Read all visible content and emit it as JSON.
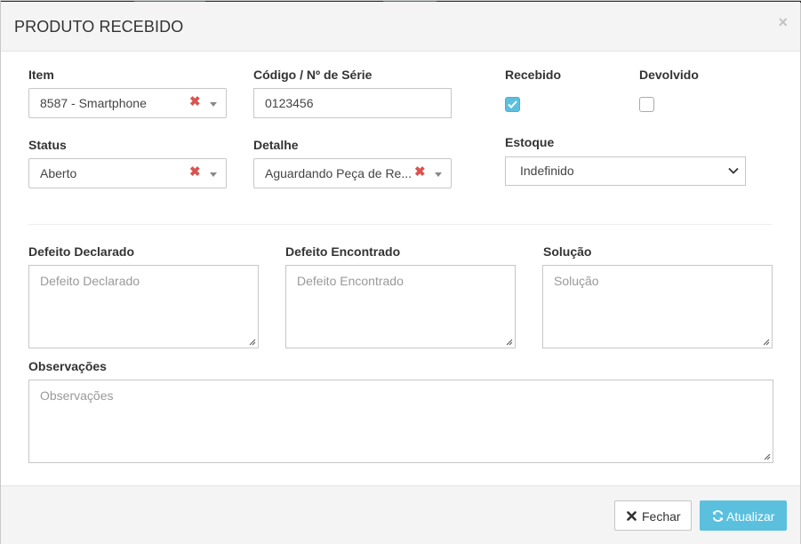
{
  "modal": {
    "title": "PRODUTO RECEBIDO",
    "close_glyph": "×"
  },
  "form": {
    "item": {
      "label": "Item",
      "value": "8587 - Smartphone",
      "clear_glyph": "✖"
    },
    "codigo": {
      "label": "Código / Nº de Série",
      "value": "0123456"
    },
    "recebido": {
      "label": "Recebido",
      "checked": true
    },
    "devolvido": {
      "label": "Devolvido",
      "checked": false
    },
    "status": {
      "label": "Status",
      "value": "Aberto",
      "clear_glyph": "✖"
    },
    "detalhe": {
      "label": "Detalhe",
      "value": "Aguardando Peça de Re...",
      "clear_glyph": "✖"
    },
    "estoque": {
      "label": "Estoque",
      "value": "Indefinido"
    },
    "defeito_declarado": {
      "label": "Defeito Declarado",
      "placeholder": "Defeito Declarado"
    },
    "defeito_encontrado": {
      "label": "Defeito Encontrado",
      "placeholder": "Defeito Encontrado"
    },
    "solucao": {
      "label": "Solução",
      "placeholder": "Solução"
    },
    "observacoes": {
      "label": "Observações",
      "placeholder": "Observações"
    }
  },
  "footer": {
    "close_button": {
      "label": "Fechar",
      "icon": "times-icon"
    },
    "update_button": {
      "label": "Atualizar",
      "icon": "refresh-icon"
    }
  },
  "colors": {
    "accent": "#5bc0de",
    "clear_red": "#d9534f",
    "header_bg": "#f4f4f4"
  }
}
